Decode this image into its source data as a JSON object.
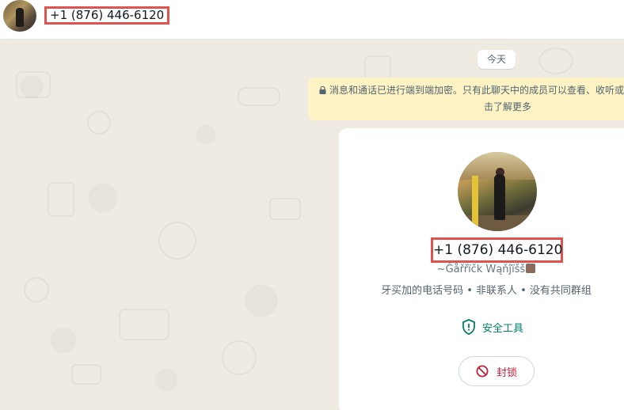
{
  "header": {
    "contact_number": "+1 (876) 446-6120"
  },
  "chat": {
    "date_label": "今天",
    "encryption_notice_line1": "消息和通话已进行端到端加密。只有此聊天中的成员可以查看、收听或",
    "encryption_notice_line2": "击了解更多"
  },
  "contact_card": {
    "number": "+1 (876) 446-6120",
    "display_name": "~Ĝåřřïčk Wąňĵïšš",
    "info": "牙买加的电话号码 • 非联系人 • 没有共同群组",
    "safety_tools_label": "安全工具",
    "block_label": "封锁"
  },
  "colors": {
    "accent_green": "#008069",
    "block_red": "#c1203a",
    "highlight_box": "#e0524d",
    "banner_yellow": "#fdf3c5",
    "chat_background": "#efeae2"
  },
  "icons": {
    "lock": "lock-icon",
    "shield": "shield-icon",
    "block": "block-icon"
  }
}
